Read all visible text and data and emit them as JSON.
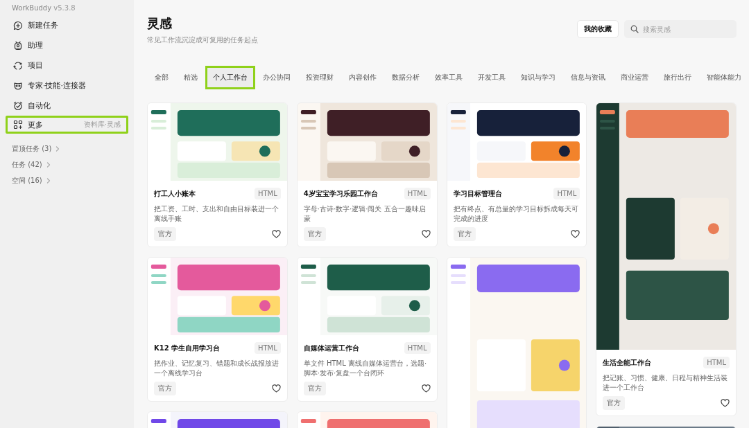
{
  "app": {
    "name": "WorkBuddy",
    "version": "v5.3.8"
  },
  "sidebar": {
    "items": [
      {
        "label": "新建任务",
        "selected": false
      },
      {
        "label": "助理",
        "selected": false
      },
      {
        "label": "项目",
        "selected": false
      },
      {
        "label": "专家·技能·连接器",
        "selected": false
      },
      {
        "label": "自动化",
        "selected": false
      },
      {
        "label": "更多",
        "selected": true,
        "hint": "资料库·灵感"
      }
    ],
    "sections": [
      {
        "label": "置顶任务 (3)"
      },
      {
        "label": "任务 (42)"
      },
      {
        "label": "空间 (16)"
      }
    ]
  },
  "page": {
    "title": "灵感",
    "subtitle": "常见工作流沉淀成可复用的任务起点",
    "favorites_button": "我的收藏",
    "search": {
      "placeholder": "搜索灵感"
    }
  },
  "tabs": [
    {
      "label": "全部",
      "selected": false
    },
    {
      "label": "精选",
      "selected": false
    },
    {
      "label": "个人工作台",
      "selected": true
    },
    {
      "label": "办公协同",
      "selected": false
    },
    {
      "label": "投资理财",
      "selected": false
    },
    {
      "label": "内容创作",
      "selected": false
    },
    {
      "label": "数据分析",
      "selected": false
    },
    {
      "label": "效率工具",
      "selected": false
    },
    {
      "label": "开发工具",
      "selected": false
    },
    {
      "label": "知识与学习",
      "selected": false
    },
    {
      "label": "信息与资讯",
      "selected": false
    },
    {
      "label": "商业运营",
      "selected": false
    },
    {
      "label": "旅行出行",
      "selected": false
    },
    {
      "label": "智能体能力",
      "selected": false
    }
  ],
  "columns": [
    {
      "cards": [
        {
          "kind": "full",
          "title": "打工人小账本",
          "tag": "HTML",
          "description": "把工资、工时、支出和自由目标装进一个离线手账",
          "badge": "官方",
          "favorited": false
        },
        {
          "kind": "full",
          "title": "K12 学生自用学习台",
          "tag": "HTML",
          "description": "把作业、记忆复习、错题和成长战报放进一个离线学习台",
          "badge": "官方",
          "favorited": false
        },
        {
          "kind": "picture"
        }
      ]
    },
    {
      "cards": [
        {
          "kind": "full",
          "title": "4岁宝宝学习乐园工作台",
          "tag": "HTML",
          "description": "字母·古诗·数字·逻辑·闯关 五合一趣味启蒙",
          "badge": "官方",
          "favorited": false
        },
        {
          "kind": "full",
          "title": "自媒体运营工作台",
          "tag": "HTML",
          "description": "单文件 HTML 离线自媒体运营台，选题·脚本·发布·复盘一个台闭环",
          "badge": "官方",
          "favorited": false
        },
        {
          "kind": "picture"
        }
      ]
    },
    {
      "cards": [
        {
          "kind": "full",
          "title": "学习目标管理台",
          "tag": "HTML",
          "description": "把有终点、有总量的学习目标拆成每天可完成的进度",
          "badge": "官方",
          "favorited": false
        },
        {
          "kind": "picture"
        }
      ]
    },
    {
      "cards": [
        {
          "kind": "full",
          "title": "生活全能工作台",
          "tag": "HTML",
          "description": "把记账、习惯、健康、日程与精神生活装进一个工作台",
          "badge": "官方",
          "favorited": false
        },
        {
          "kind": "picture"
        }
      ]
    }
  ]
}
